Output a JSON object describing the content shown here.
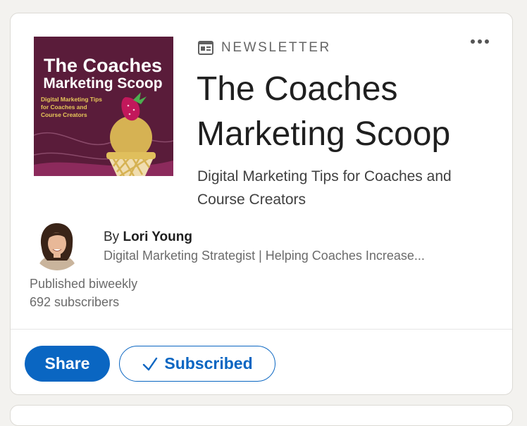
{
  "newsletter": {
    "type_label": "NEWSLETTER",
    "title": "The Coaches Marketing Scoop",
    "description": "Digital Marketing Tips for Coaches and Course Creators",
    "cover": {
      "title_line1": "The Coaches",
      "title_line2": "Marketing Scoop",
      "tagline_line1": "Digital Marketing Tips",
      "tagline_line2": "for Coaches and",
      "tagline_line3": "Course Creators",
      "colors": {
        "background": "#5a1c3a",
        "scoop": "#d6b253",
        "cone": "#f0ddb0",
        "strawberry": "#c2185b",
        "leaf": "#4caf50"
      }
    }
  },
  "author": {
    "by_prefix": "By",
    "name": "Lori Young",
    "headline": "Digital Marketing Strategist | Helping Coaches Increase..."
  },
  "meta": {
    "frequency": "Published biweekly",
    "subscribers": "692 subscribers"
  },
  "actions": {
    "share_label": "Share",
    "subscribed_label": "Subscribed",
    "subscribed_icon": "checkmark-icon",
    "more_icon": "more-options-icon"
  },
  "icons": {
    "newsletter": "newsletter-icon"
  },
  "colors": {
    "accent": "#0a66c2",
    "page_background": "#f3f2ef",
    "card_background": "#ffffff"
  }
}
